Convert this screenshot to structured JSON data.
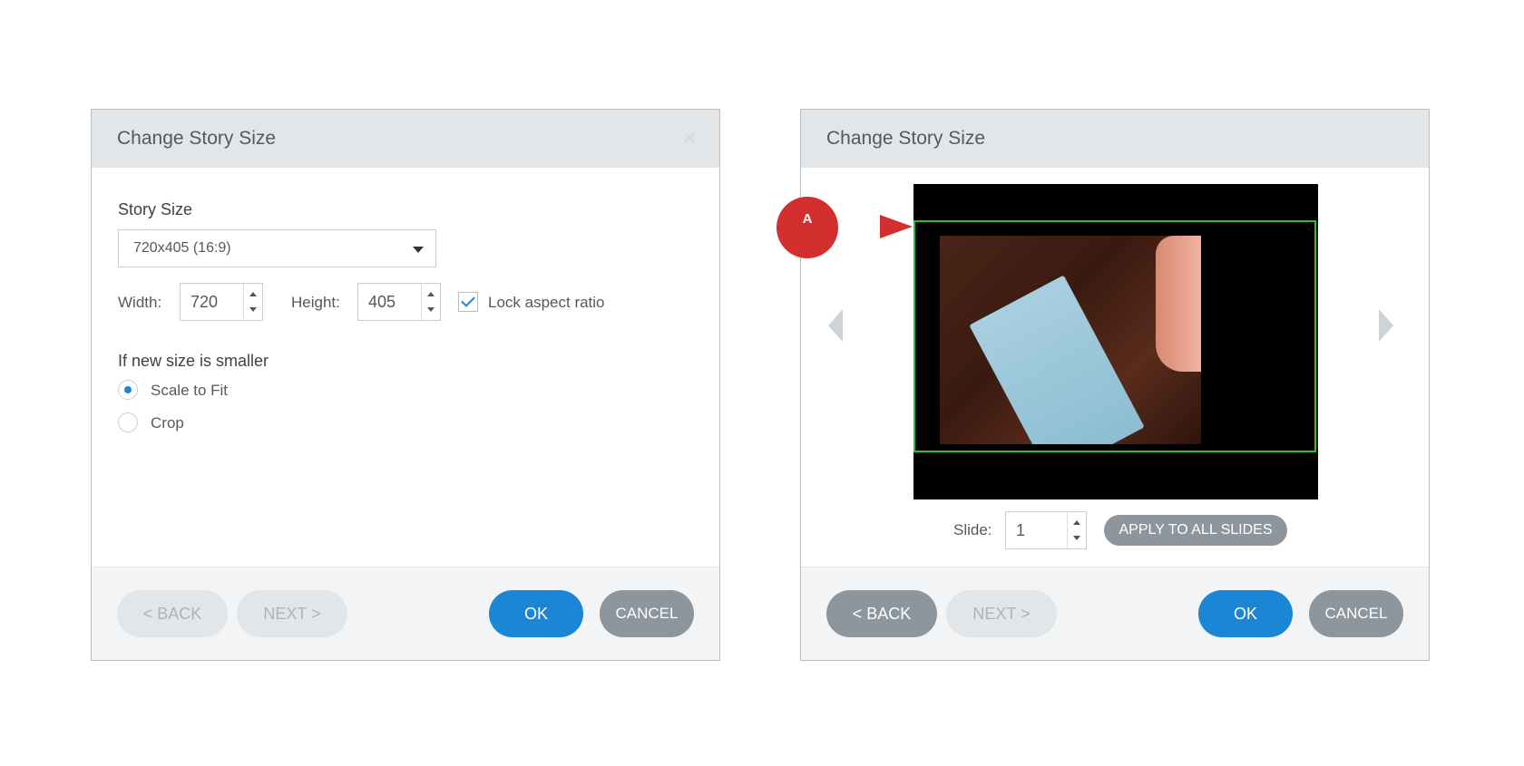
{
  "dialog_left": {
    "title": "Change Story Size",
    "close_glyph": "×",
    "story_size_label": "Story Size",
    "story_size_value": "720x405 (16:9)",
    "width_label": "Width:",
    "width_value": "720",
    "height_label": "Height:",
    "height_value": "405",
    "lock_label": "Lock aspect ratio",
    "lock_checked": true,
    "smaller_label": "If new size is smaller",
    "options": [
      {
        "label": "Scale to Fit",
        "selected": true
      },
      {
        "label": "Crop",
        "selected": false
      }
    ],
    "buttons": {
      "back": "< BACK",
      "next": "NEXT >",
      "ok": "OK",
      "cancel": "CANCEL"
    }
  },
  "dialog_right": {
    "title": "Change Story Size",
    "slide_label": "Slide:",
    "slide_value": "1",
    "apply_all": "APPLY TO ALL SLIDES",
    "buttons": {
      "back": "< BACK",
      "next": "NEXT >",
      "ok": "OK",
      "cancel": "CANCEL"
    }
  },
  "callout": {
    "badge": "A"
  },
  "colors": {
    "accent": "#1b85d6",
    "crop_frame": "#22c33a",
    "callout": "#d32f2f"
  }
}
